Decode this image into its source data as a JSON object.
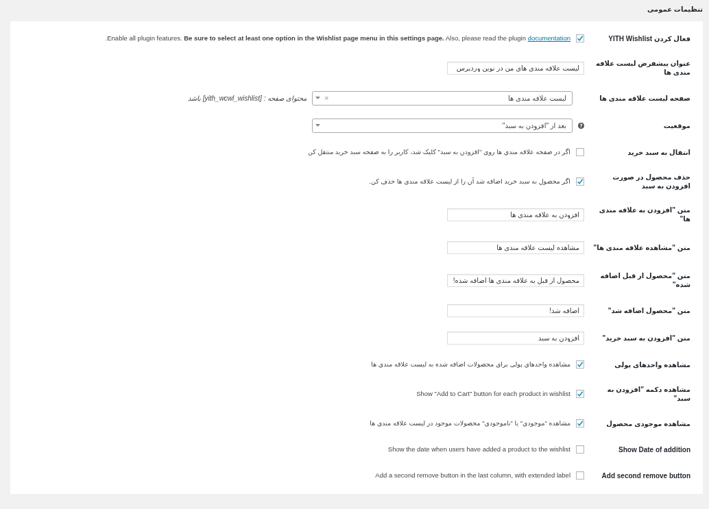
{
  "title": "تنظیمات عمومی",
  "rows": [
    {
      "kind": "checkbox",
      "label": "فعال کردن YITH Wishlist",
      "checked": true,
      "description": "Enable all plugin features. **Be sure to select at least one option in the Wishlist page menu in this settings page.** Also, please read the plugin ",
      "link": "documentation",
      "after": "."
    },
    {
      "kind": "text",
      "label": "عنوان پیشفرض لیست علاقه مندی ها",
      "value": "لیست علاقه مندی های من در نوین وردپرس"
    },
    {
      "kind": "select",
      "label": "صفحه لیست علاقه مندی ها",
      "value": "لیست علاقه مندی ها",
      "clear": "×",
      "note": "محتوای صفحه : [yith_wcwl_wishlist] باشد"
    },
    {
      "kind": "select",
      "label": "موقعیت",
      "value": "بعد از \"افزودن به سبد\"",
      "help": "?"
    },
    {
      "kind": "checkbox",
      "label": "انتقال به سبد خرید",
      "checked": false,
      "description": "اگر در صفحه علاقه مندی ها روی \"افزودن به سبد\" کلیک شد، کاربر را به صفحه سبد خرید منتقل کن"
    },
    {
      "kind": "checkbox",
      "label": "حذف محصول در صورت افزودن به سبد",
      "checked": true,
      "description": "اگر محصول به سبد خرید اضافه شد آن را از لیست علاقه مندی ها حذف کن."
    },
    {
      "kind": "text",
      "label": "متن \"افزودن به علاقه مندی ها\"",
      "value": "افزودن به علاقه مندی ها"
    },
    {
      "kind": "text",
      "label": "متن \"مشاهده علاقه مندی ها\"",
      "value": "مشاهده لیست علاقه مندی ها"
    },
    {
      "kind": "text",
      "label": "متن \"محصول از قبل اضافه شده\"",
      "value": "محصول از قبل به علاقه مندی ها اضافه شده!"
    },
    {
      "kind": "text",
      "label": "متن \"محصول اضافه شد\"",
      "value": "اضافه شد!"
    },
    {
      "kind": "text",
      "label": "متن \"افزودن به سبد خرید\"",
      "value": "افزودن به سبد"
    },
    {
      "kind": "checkbox",
      "label": "مشاهده واحدهای پولی",
      "checked": true,
      "description": "مشاهده واحدهای پولی برای محصولات اضافه شده به لیست علاقه مندی ها"
    },
    {
      "kind": "checkbox",
      "label": "مشاهده دکمه \"افزودن به سبد\"",
      "checked": true,
      "description": "Show \"Add to Cart\" button for each product in wishlist"
    },
    {
      "kind": "checkbox",
      "label": "مشاهده موجودی محصول",
      "checked": true,
      "description": "مشاهده \"موجودی\" یا \"ناموجودی\" محصولات موجود در لیست علاقه مندی ها"
    },
    {
      "kind": "checkbox",
      "label": "Show Date of addition",
      "checked": false,
      "description": "Show the date when users have added a product to the wishlist"
    },
    {
      "kind": "checkbox",
      "label": "Add second remove button",
      "checked": false,
      "description": "Add a second remove button in the last column, with extended label"
    }
  ]
}
